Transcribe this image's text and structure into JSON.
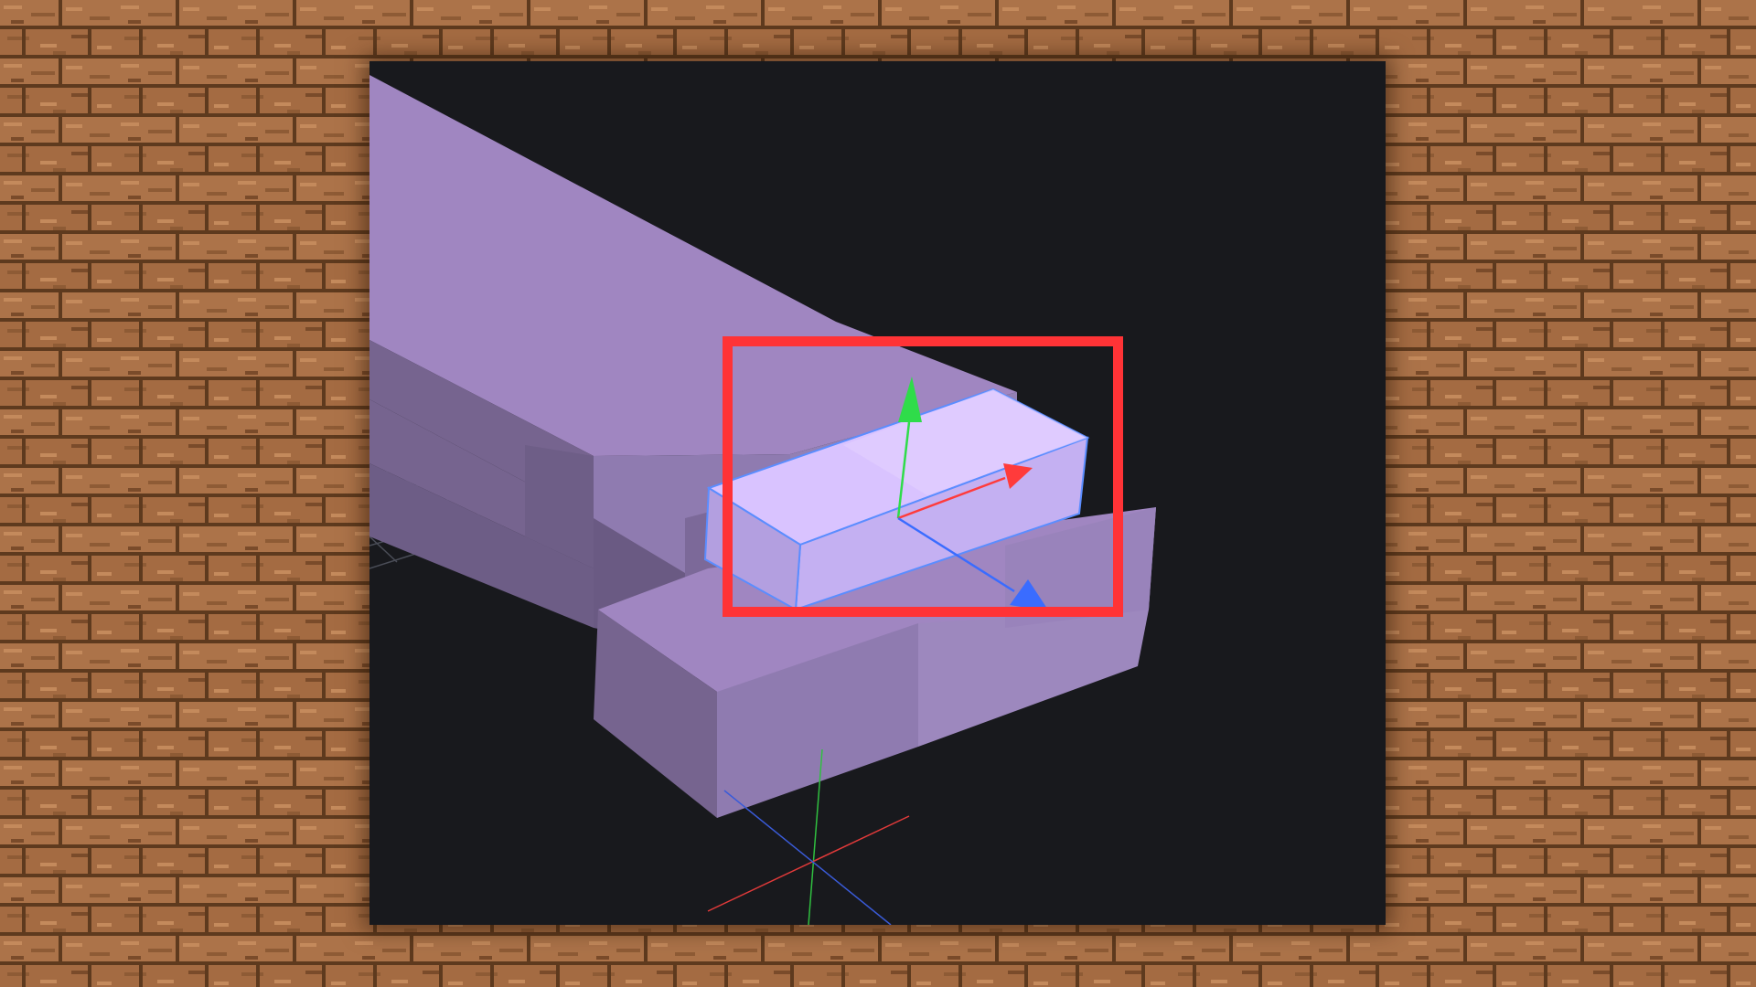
{
  "background": {
    "pattern": "oak-planks-texture",
    "plank_base_color": "#a86f45",
    "plank_light_color": "#c48a5c",
    "plank_dark_color": "#7a4b2a",
    "seam_color": "#5e3a1e"
  },
  "viewport": {
    "background_color": "#18191d",
    "model": {
      "cube_color": "#a089c2",
      "cube_top_color": "#a086c1",
      "cube_side_color": "#76648f",
      "cube_front_color": "#8f7bb0",
      "selected_cube_color": "#d9c3ff",
      "selected_outline_color": "#5b8dff"
    },
    "gizmo": {
      "x_axis_color": "#ff3b3b",
      "y_axis_color": "#2fdc4a",
      "z_axis_color": "#3a6cff"
    },
    "origin_axes": {
      "x_axis_color": "#e23a3a",
      "y_axis_color": "#30c040",
      "z_axis_color": "#3a5bd8"
    },
    "grid_color": "#4a4d57"
  },
  "highlight": {
    "color": "#ff3336",
    "target": "selected-cube-with-move-gizmo"
  }
}
